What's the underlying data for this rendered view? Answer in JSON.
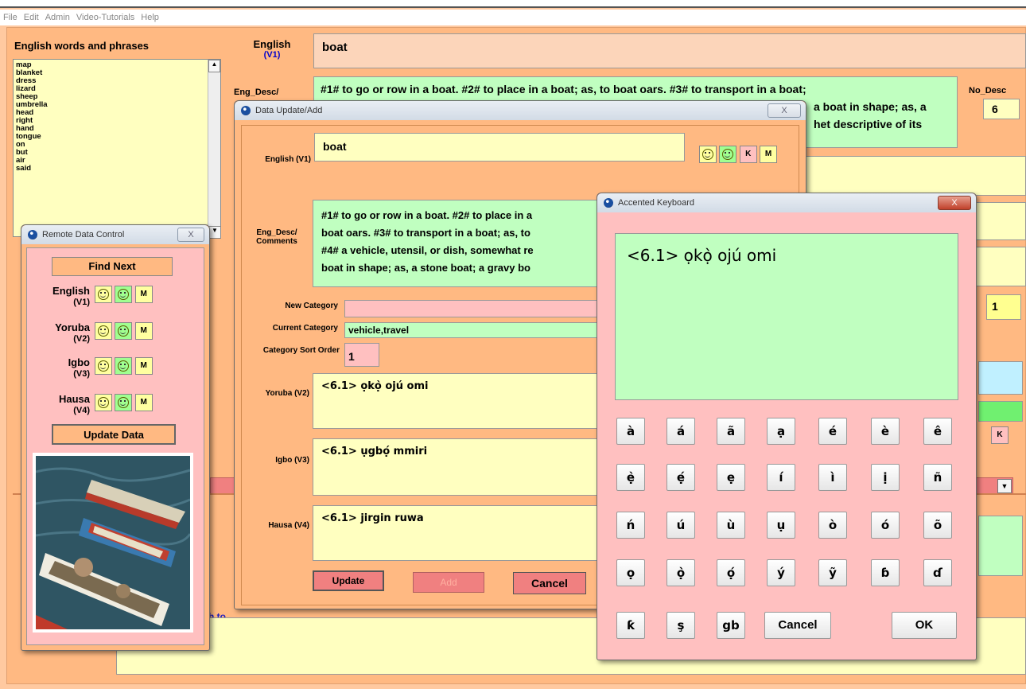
{
  "menu": [
    "File",
    "Edit",
    "Admin",
    "Video-Tutorials",
    "Help"
  ],
  "main": {
    "list_title": "English words and phrases",
    "words": [
      "map",
      "blanket",
      "dress",
      "lizard",
      "sheep",
      "umbrella",
      "head",
      "right",
      "hand",
      "tongue",
      "on",
      "but",
      "air",
      "said"
    ],
    "english_label": "English",
    "english_version": "(V1)",
    "english_value": "boat",
    "eng_desc_label": "Eng_Desc/",
    "desc_line1": "#1# to go or row in a boat. #2# to place in a boat; as, to boat oars. #3# to transport in a boat;",
    "desc_line2": "a boat in shape; as, a",
    "desc_line3": "het descriptive of its",
    "no_desc_label": "No_Desc",
    "no_desc_value": "6",
    "right_number": "1",
    "k_label": "K",
    "partial_text": "h to"
  },
  "remote": {
    "title": "Remote Data Control",
    "close": "X",
    "find_next": "Find Next",
    "rows": [
      {
        "lang": "English",
        "version": "(V1)"
      },
      {
        "lang": "Yoruba",
        "version": "(V2)"
      },
      {
        "lang": "Igbo",
        "version": "(V3)"
      },
      {
        "lang": "Hausa",
        "version": "(V4)"
      }
    ],
    "m_label": "M",
    "update_data": "Update Data"
  },
  "update_dialog": {
    "title": "Data Update/Add",
    "close": "X",
    "english_label": "English (V1)",
    "english_value": "boat",
    "k_label": "K",
    "m_label": "M",
    "desc_label_1": "Eng_Desc/",
    "desc_label_2": "Comments",
    "desc_lines": [
      "#1# to go or row in a boat. #2# to place in a",
      "boat oars. #3# to transport in a boat; as, to",
      "#4# a vehicle, utensil, or dish, somewhat re",
      "boat in shape; as, a stone boat; a gravy bo"
    ],
    "new_category_label": "New Category",
    "new_category_value": "",
    "current_category_label": "Current Category",
    "current_category_value": "vehicle,travel",
    "sort_order_label": "Category Sort Order",
    "sort_order_value": "1",
    "yoruba_label": "Yoruba (V2)",
    "yoruba_value": "<6.1> ọkọ̀ ojú omi",
    "igbo_label": "Igbo (V3)",
    "igbo_value": "<6.1> ụgbọ́ mmiri",
    "hausa_label": "Hausa (V4)",
    "hausa_value": "<6.1> jirgin ruwa",
    "update": "Update",
    "add": "Add",
    "cancel": "Cancel"
  },
  "keyboard": {
    "title": "Accented Keyboard",
    "close": "X",
    "text": "<6.1> ọkọ̀ ojú omi",
    "rows": [
      [
        "à",
        "á",
        "ã",
        "ạ",
        "é",
        "è",
        "ê"
      ],
      [
        "ẹ̀",
        "ẹ́",
        "ẹ",
        "í",
        "ì",
        "ị",
        "ñ"
      ],
      [
        "ń",
        "ú",
        "ù",
        "ụ",
        "ò",
        "ó",
        "õ"
      ],
      [
        "ọ",
        "ọ̀",
        "ọ́",
        "ý",
        "ỹ",
        "ɓ",
        "ɗ"
      ],
      [
        "ƙ",
        "ş",
        "gb"
      ]
    ],
    "cancel": "Cancel",
    "ok": "OK"
  }
}
